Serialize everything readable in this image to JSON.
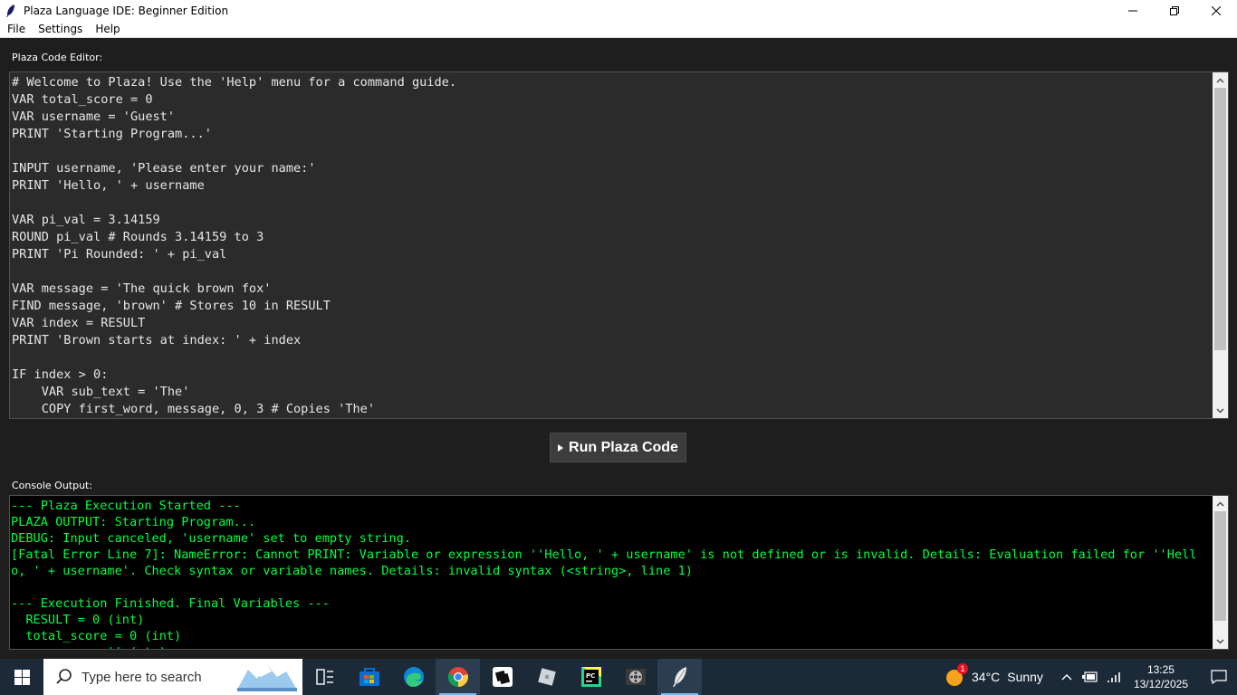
{
  "window": {
    "title": "Plaza Language IDE: Beginner Edition"
  },
  "menu": {
    "items": [
      "File",
      "Settings",
      "Help"
    ]
  },
  "editor": {
    "label": "Plaza Code Editor:",
    "code": "# Welcome to Plaza! Use the 'Help' menu for a command guide.\nVAR total_score = 0\nVAR username = 'Guest'\nPRINT 'Starting Program...'\n\nINPUT username, 'Please enter your name:'\nPRINT 'Hello, ' + username\n\nVAR pi_val = 3.14159\nROUND pi_val # Rounds 3.14159 to 3\nPRINT 'Pi Rounded: ' + pi_val\n\nVAR message = 'The quick brown fox'\nFIND message, 'brown' # Stores 10 in RESULT\nVAR index = RESULT\nPRINT 'Brown starts at index: ' + index\n\nIF index > 0:\n    VAR sub_text = 'The'\n    COPY first_word, message, 0, 3 # Copies 'The'"
  },
  "run_button": {
    "label": "Run Plaza Code"
  },
  "console": {
    "label": "Console Output:",
    "text": "--- Plaza Execution Started ---\nPLAZA OUTPUT: Starting Program...\nDEBUG: Input canceled, 'username' set to empty string.\n[Fatal Error Line 7]: NameError: Cannot PRINT: Variable or expression ''Hello, ' + username' is not defined or is invalid. Details: Evaluation failed for ''Hello, ' + username'. Check syntax or variable names. Details: invalid syntax (<string>, line 1)\n\n--- Execution Finished. Final Variables ---\n  RESULT = 0 (int)\n  total_score = 0 (int)\n  username = '' (str)"
  },
  "taskbar": {
    "search_placeholder": "Type here to search",
    "weather": {
      "badge": "1",
      "temp": "34°C",
      "condition": "Sunny"
    },
    "clock": {
      "time": "13:25",
      "date": "13/12/2025"
    },
    "apps": [
      "task-view",
      "microsoft-store",
      "edge",
      "chrome",
      "roblox-studio",
      "roblox",
      "pycharm",
      "media-player",
      "plaza-ide"
    ]
  },
  "colors": {
    "console_text": "#00ff41",
    "editor_bg": "#2b2b2b",
    "window_bg": "#1e1e1e",
    "taskbar_bg": "#1c2a38"
  }
}
